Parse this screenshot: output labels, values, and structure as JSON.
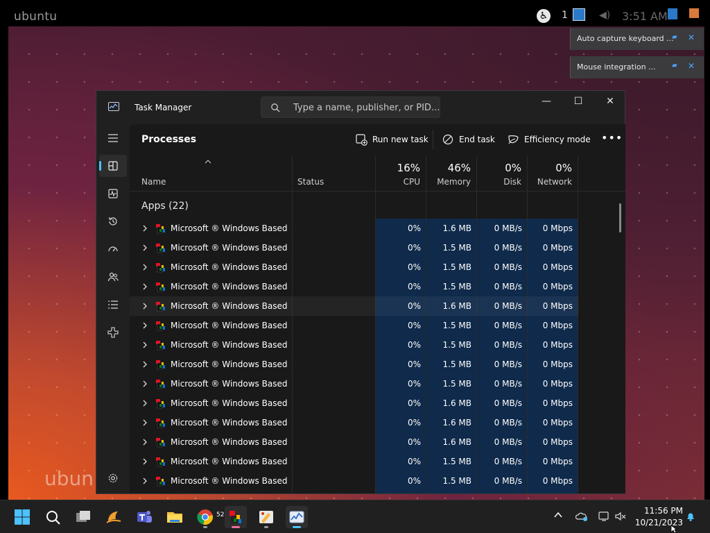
{
  "ubuntu": {
    "logo_text": "ubuntu",
    "clock": "3:51 AM",
    "watermark": "ubun",
    "tray_glyph": "1"
  },
  "vm_notifications": [
    {
      "text": "Auto capture keyboard ..."
    },
    {
      "text": "Mouse integration ..."
    }
  ],
  "task_manager": {
    "title": "Task Manager",
    "search_placeholder": "Type a name, publisher, or PID...",
    "window_buttons": {
      "minimize": "—",
      "maximize": "☐",
      "close": "✕"
    },
    "page_heading": "Processes",
    "toolbar": {
      "run_new_task": "Run new task",
      "end_task": "End task",
      "efficiency_mode": "Efficiency mode",
      "more": "•••"
    },
    "columns": {
      "name": "Name",
      "status": "Status",
      "cpu": {
        "percent": "16%",
        "label": "CPU"
      },
      "memory": {
        "percent": "46%",
        "label": "Memory"
      },
      "disk": {
        "percent": "0%",
        "label": "Disk"
      },
      "network": {
        "percent": "0%",
        "label": "Network"
      }
    },
    "group_label": "Apps (22)",
    "rows": [
      {
        "name": "Microsoft ® Windows Based S...",
        "cpu": "0%",
        "memory": "1.6 MB",
        "disk": "0 MB/s",
        "network": "0 Mbps"
      },
      {
        "name": "Microsoft ® Windows Based S...",
        "cpu": "0%",
        "memory": "1.5 MB",
        "disk": "0 MB/s",
        "network": "0 Mbps"
      },
      {
        "name": "Microsoft ® Windows Based S...",
        "cpu": "0%",
        "memory": "1.5 MB",
        "disk": "0 MB/s",
        "network": "0 Mbps"
      },
      {
        "name": "Microsoft ® Windows Based S...",
        "cpu": "0%",
        "memory": "1.5 MB",
        "disk": "0 MB/s",
        "network": "0 Mbps"
      },
      {
        "name": "Microsoft ® Windows Based S...",
        "cpu": "0%",
        "memory": "1.6 MB",
        "disk": "0 MB/s",
        "network": "0 Mbps"
      },
      {
        "name": "Microsoft ® Windows Based S...",
        "cpu": "0%",
        "memory": "1.5 MB",
        "disk": "0 MB/s",
        "network": "0 Mbps"
      },
      {
        "name": "Microsoft ® Windows Based S...",
        "cpu": "0%",
        "memory": "1.5 MB",
        "disk": "0 MB/s",
        "network": "0 Mbps"
      },
      {
        "name": "Microsoft ® Windows Based S...",
        "cpu": "0%",
        "memory": "1.5 MB",
        "disk": "0 MB/s",
        "network": "0 Mbps"
      },
      {
        "name": "Microsoft ® Windows Based S...",
        "cpu": "0%",
        "memory": "1.5 MB",
        "disk": "0 MB/s",
        "network": "0 Mbps"
      },
      {
        "name": "Microsoft ® Windows Based S...",
        "cpu": "0%",
        "memory": "1.6 MB",
        "disk": "0 MB/s",
        "network": "0 Mbps"
      },
      {
        "name": "Microsoft ® Windows Based S...",
        "cpu": "0%",
        "memory": "1.6 MB",
        "disk": "0 MB/s",
        "network": "0 Mbps"
      },
      {
        "name": "Microsoft ® Windows Based S...",
        "cpu": "0%",
        "memory": "1.6 MB",
        "disk": "0 MB/s",
        "network": "0 Mbps"
      },
      {
        "name": "Microsoft ® Windows Based S...",
        "cpu": "0%",
        "memory": "1.5 MB",
        "disk": "0 MB/s",
        "network": "0 Mbps"
      },
      {
        "name": "Microsoft ® Windows Based S...",
        "cpu": "0%",
        "memory": "1.5 MB",
        "disk": "0 MB/s",
        "network": "0 Mbps"
      }
    ],
    "nav_items": [
      "processes-icon",
      "performance-icon",
      "app-history-icon",
      "startup-apps-icon",
      "users-icon",
      "details-icon",
      "services-icon",
      "settings-icon"
    ]
  },
  "taskbar": {
    "weather_temp": "52°",
    "clock_time": "11:56 PM",
    "clock_date": "10/21/2023",
    "apps": [
      "start-icon",
      "search-icon",
      "task-view-icon",
      "weather-icon",
      "teams-icon",
      "file-explorer-icon",
      "chrome-icon",
      "windows-based-script-host-icon",
      "paint-icon",
      "task-manager-icon"
    ]
  },
  "colors": {
    "accent": "#4cc2ff",
    "heatmap_low": "#0f2a4a",
    "window_bg": "#202020",
    "content_bg": "#191919"
  }
}
